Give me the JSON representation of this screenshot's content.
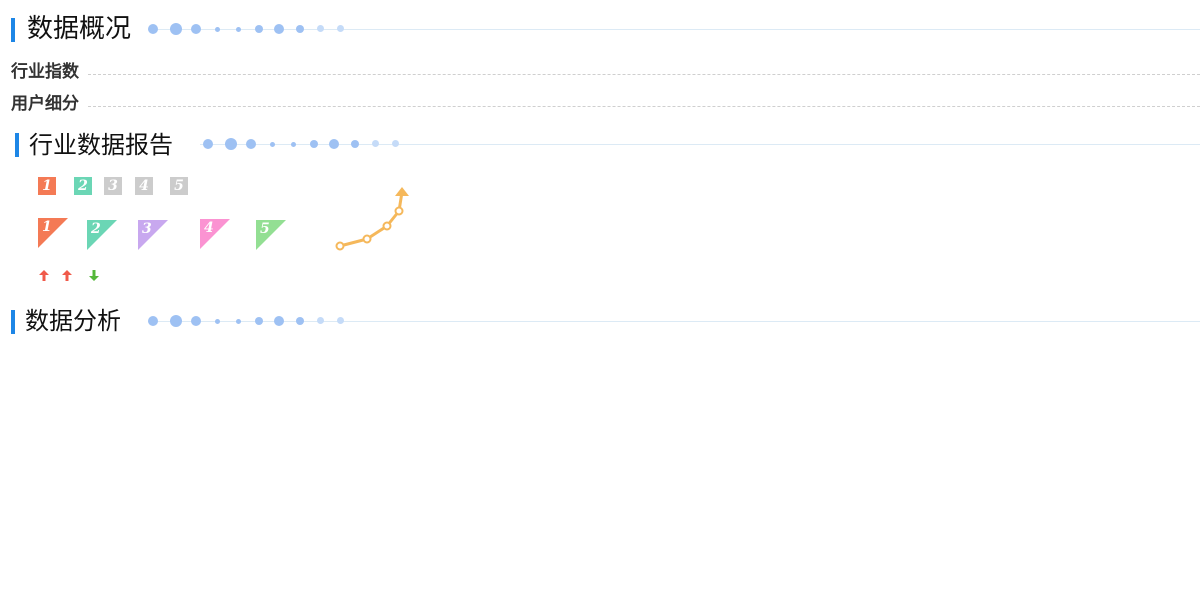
{
  "sections": {
    "overview": {
      "title": "数据概况"
    },
    "report": {
      "title": "行业数据报告"
    },
    "analysis": {
      "title": "数据分析"
    }
  },
  "subsections": [
    {
      "label": "行业指数"
    },
    {
      "label": "用户细分"
    }
  ],
  "rank_squares": [
    {
      "num": "1",
      "color": "#f47a55"
    },
    {
      "num": "2",
      "color": "#6bd6b5"
    },
    {
      "num": "3",
      "color": "#cccccc"
    },
    {
      "num": "4",
      "color": "#cccccc"
    },
    {
      "num": "5",
      "color": "#cccccc"
    }
  ],
  "rank_triangles": [
    {
      "num": "1",
      "color": "#f47a55"
    },
    {
      "num": "2",
      "color": "#6bd6b5"
    },
    {
      "num": "3",
      "color": "#c8a8ef"
    },
    {
      "num": "4",
      "color": "#fb93d2"
    },
    {
      "num": "5",
      "color": "#93df93"
    }
  ],
  "trend_arrows": [
    {
      "dir": "up",
      "color": "#f05a4a"
    },
    {
      "dir": "up",
      "color": "#f05a4a"
    },
    {
      "dir": "down",
      "color": "#55b83a"
    }
  ],
  "colors": {
    "accent": "#1d86e6",
    "dot": "#9ec1f3",
    "trend_line": "#f5b85b"
  }
}
